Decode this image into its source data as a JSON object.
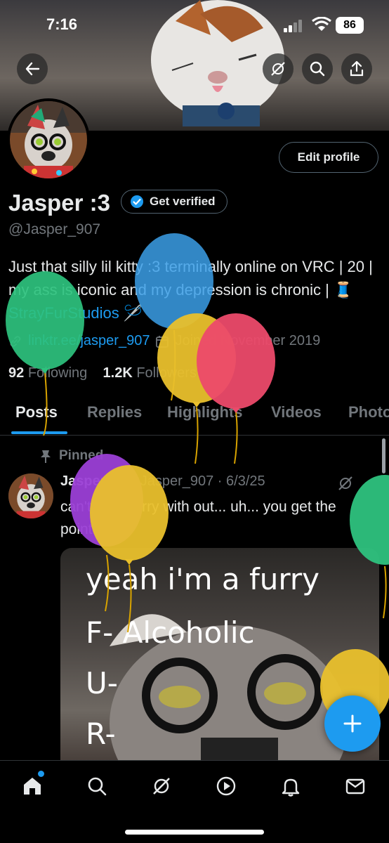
{
  "status_bar": {
    "time": "7:16",
    "battery": "86"
  },
  "profile": {
    "name": "Jasper :3",
    "verify_label": "Get verified",
    "handle": "@Jasper_907",
    "edit_label": "Edit profile",
    "bio_part1": "Just that silly lil kitty :3 terminally online on VRC | 20 | my ass is iconic and my depression is chronic | 🧵 ",
    "bio_link": "StrayFurStudios",
    "bio_part2": " 🪡",
    "link": "linktr.ee/jasper_907",
    "joined": "Joined November 2019",
    "following_count": "92",
    "following_label": "Following",
    "followers_count": "1.2K",
    "followers_label": "Followers"
  },
  "tabs": [
    "Posts",
    "Replies",
    "Highlights",
    "Videos",
    "Photos"
  ],
  "post": {
    "pinned_label": "Pinned",
    "author": "Jasper :3",
    "handle": "@Jasper_907",
    "date": "· 6/3/25",
    "text": "can't spell furry with out... uh... you get the point...",
    "media_lines": [
      "yeah i'm a furry",
      "F- Alcoholic",
      "U-",
      "R-"
    ]
  },
  "icons": {
    "top": [
      "back-arrow-icon",
      "grok-icon",
      "search-icon",
      "share-icon"
    ],
    "nav": [
      "home-icon",
      "search-icon",
      "grok-icon",
      "video-icon",
      "notifications-icon",
      "messages-icon"
    ]
  },
  "colors": {
    "accent": "#1d9bf0",
    "text": "#e7e9ea",
    "muted": "#71767b",
    "border": "#2f3336"
  }
}
